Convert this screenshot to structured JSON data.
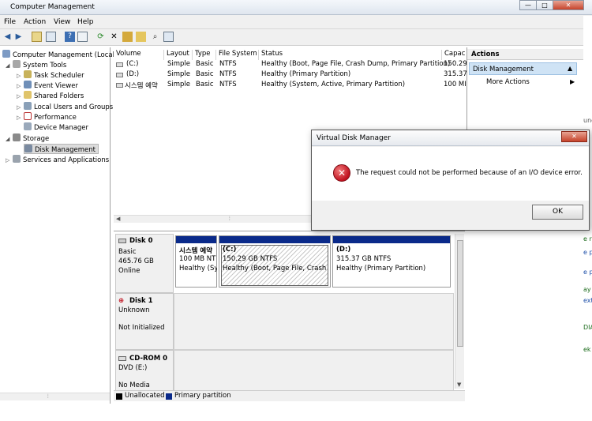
{
  "window": {
    "title": "Computer Management",
    "min": "—",
    "max": "□",
    "close": "✕"
  },
  "menu": [
    "File",
    "Action",
    "View",
    "Help"
  ],
  "tree": {
    "root": "Computer Management (Local",
    "items": [
      "System Tools",
      "Task Scheduler",
      "Event Viewer",
      "Shared Folders",
      "Local Users and Groups",
      "Performance",
      "Device Manager",
      "Storage",
      "Disk Management",
      "Services and Applications"
    ]
  },
  "volumes": {
    "columns": [
      "Volume",
      "Layout",
      "Type",
      "File System",
      "Status",
      "Capac"
    ],
    "rows": [
      [
        "(C:)",
        "Simple",
        "Basic",
        "NTFS",
        "Healthy (Boot, Page File, Crash Dump, Primary Partition)",
        "150.29"
      ],
      [
        "(D:)",
        "Simple",
        "Basic",
        "NTFS",
        "Healthy (Primary Partition)",
        "315.37"
      ],
      [
        "시스템 예약",
        "Simple",
        "Basic",
        "NTFS",
        "Healthy (System, Active, Primary Partition)",
        "100 MI"
      ]
    ]
  },
  "actions": {
    "header": "Actions",
    "section": "Disk Management",
    "more": "More Actions"
  },
  "disks": {
    "disk0": {
      "name": "Disk 0",
      "type": "Basic",
      "size": "465.76 GB",
      "state": "Online"
    },
    "partitions": [
      {
        "name": "시스템 예약",
        "size": "100 MB NT",
        "status": "Healthy (Sy"
      },
      {
        "name": "(C:)",
        "size": "150.29 GB NTFS",
        "status": "Healthy (Boot, Page File, Crash Du"
      },
      {
        "name": "(D:)",
        "size": "315.37 GB NTFS",
        "status": "Healthy (Primary Partition)"
      }
    ],
    "disk1": {
      "name": "Disk 1",
      "type": "Unknown",
      "state": "Not Initialized"
    },
    "cdrom": {
      "name": "CD-ROM 0",
      "type": "DVD (E:)",
      "state": "No Media"
    },
    "legend": {
      "unallocated": "Unallocated",
      "primary": "Primary partition"
    }
  },
  "dialog": {
    "title": "Virtual Disk Manager",
    "message": "The request could not be performed because of an I/O device error.",
    "ok": "OK",
    "close": "✕"
  },
  "right_strip": [
    "unc",
    "e r",
    "e p",
    "e p",
    "ay",
    "ext",
    "DIA",
    "ek"
  ],
  "colors": {
    "partition_bar": "#0a2a8a",
    "selection": "#cce4f7",
    "error": "#c0111f"
  }
}
